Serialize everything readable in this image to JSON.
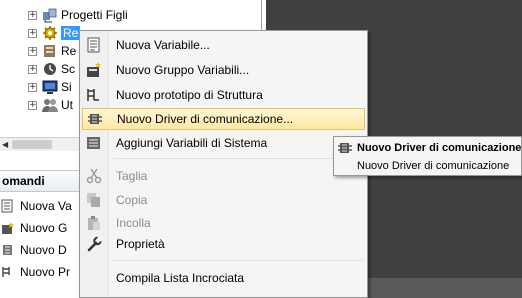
{
  "tree": {
    "items": [
      {
        "label": "Progetti Figli",
        "icon": "project-children-icon"
      },
      {
        "label": "Re",
        "icon": "gear-icon"
      },
      {
        "label": "Re",
        "icon": "recipe-icon"
      },
      {
        "label": "Sc",
        "icon": "script-icon"
      },
      {
        "label": "Si",
        "icon": "screen-icon"
      },
      {
        "label": "Ut",
        "icon": "users-icon"
      }
    ]
  },
  "commands": {
    "header": "omandi",
    "items": [
      {
        "label": "Nuova Va",
        "icon": "new-variable-icon"
      },
      {
        "label": "Nuovo G",
        "icon": "new-group-icon"
      },
      {
        "label": "Nuovo D",
        "icon": "new-driver-icon"
      },
      {
        "label": "Nuovo Pr",
        "icon": "new-prototype-icon"
      }
    ]
  },
  "context_menu": {
    "items": [
      {
        "label": "Nuova Variabile...",
        "icon": "new-variable-icon",
        "enabled": true
      },
      {
        "label": "Nuovo Gruppo Variabili...",
        "icon": "new-variable-group-icon",
        "enabled": true
      },
      {
        "label": "Nuovo prototipo di Struttura",
        "icon": "structure-prototype-icon",
        "enabled": true
      },
      {
        "label": "Nuovo Driver di comunicazione...",
        "icon": "communication-driver-icon",
        "enabled": true,
        "highlighted": true
      },
      {
        "label": "Aggiungi Variabili di Sistema",
        "icon": "system-variables-icon",
        "enabled": true
      },
      {
        "label": "Taglia",
        "icon": "cut-icon",
        "enabled": false
      },
      {
        "label": "Copia",
        "icon": "copy-icon",
        "enabled": false
      },
      {
        "label": "Incolla",
        "icon": "paste-icon",
        "enabled": false
      },
      {
        "label": "Proprietà",
        "icon": "properties-wrench-icon",
        "enabled": true
      },
      {
        "label": "Compila Lista Incrociata",
        "icon": "",
        "enabled": true
      }
    ]
  },
  "submenu": {
    "items": [
      {
        "label": "Nuovo Driver di comunicazione",
        "icon": "communication-driver-icon",
        "bold": true
      },
      {
        "label": "Nuovo Driver di comunicazione",
        "icon": "",
        "bold": false
      }
    ]
  },
  "colors": {
    "selection": "#3399ff",
    "workspace": "#404040",
    "menu_highlight": "#fde9a2"
  }
}
